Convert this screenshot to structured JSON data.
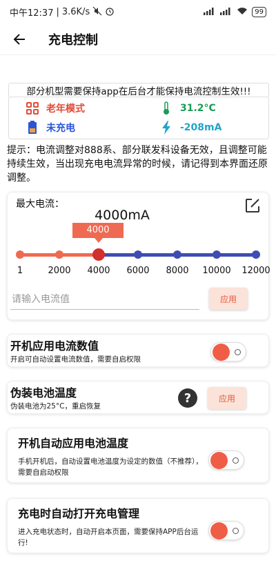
{
  "status_bar": {
    "time": "中午12:37",
    "net_speed": "3.6K/s",
    "battery": "99"
  },
  "app_bar": {
    "title": "充电控制"
  },
  "warning_text": "部分机型需要保持app在后台才能保持电流控制生效!!!",
  "info": {
    "mode_label": "老年模式",
    "temperature": "31.2°C",
    "charge_state": "未充电",
    "current": "-208mA",
    "colors": {
      "red": "#e24a36",
      "green": "#1a9b55",
      "blue": "#2b55d8",
      "teal": "#22a4c9"
    }
  },
  "tip_text": "提示：电流调整对888系、部分联发科设备无效，且调整可能持续生效，当出现充电电流异常的时候，请记得到本界面还原调整。",
  "max_current": {
    "label": "最大电流：",
    "value_text": "4000mA",
    "slider": {
      "selected": 4000,
      "tooltip": "4000",
      "ticks": [
        "1",
        "2000",
        "4000",
        "6000",
        "8000",
        "10000",
        "12000"
      ],
      "tick_values": [
        1,
        2000,
        4000,
        6000,
        8000,
        10000,
        12000
      ],
      "active_color": "#ef6a52",
      "inactive_color": "#3e4db2"
    },
    "input_placeholder": "请输入电流值",
    "apply_label": "应用"
  },
  "boot_apply_current": {
    "title": "开机应用电流数值",
    "description": "开启可自动设置电流数值，需要自启权限",
    "enabled": true
  },
  "fake_temperature": {
    "title": "伪装电池温度",
    "description": "伪装电池为25°C，重启恢复",
    "help": "?",
    "apply_label": "应用"
  },
  "boot_apply_temperature": {
    "title": "开机自动应用电池温度",
    "description": "手机开机后，自动设置电池温度为设定的数值（不推荐），需要自启动权限",
    "enabled": true
  },
  "auto_open_charge": {
    "title": "充电时自动打开充电管理",
    "description": "进入充电状态时，自动开启本页面，需要保持APP后台运行!",
    "enabled": true
  }
}
